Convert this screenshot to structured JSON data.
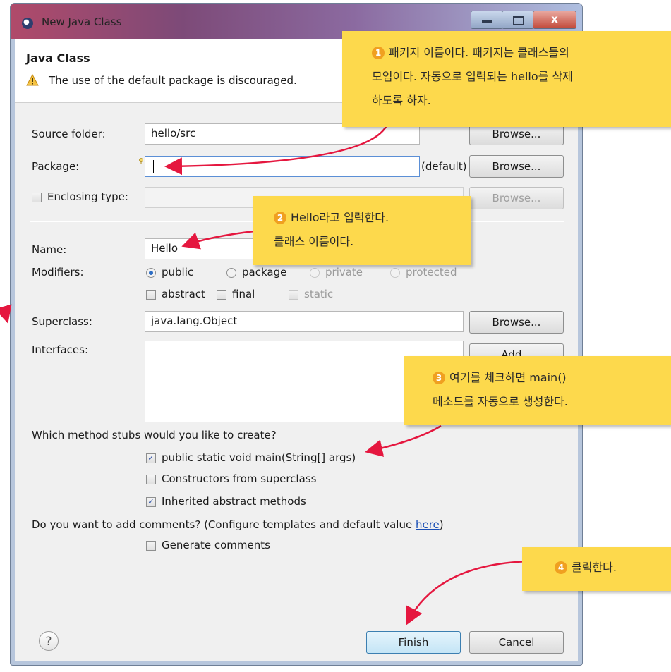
{
  "window": {
    "title": "New Java Class",
    "close_glyph": "x"
  },
  "header": {
    "title": "Java Class",
    "warning": "The use of the default package is discouraged."
  },
  "form": {
    "source_folder": {
      "label": "Source folder:",
      "value": "hello/src",
      "button": "Browse..."
    },
    "package": {
      "label": "Package:",
      "value": "",
      "suffix": "(default)",
      "button": "Browse..."
    },
    "enclosing": {
      "label": "Enclosing type:",
      "value": "",
      "button": "Browse...",
      "checked": false
    },
    "name": {
      "label": "Name:",
      "value": "Hello"
    },
    "modifiers": {
      "label": "Modifiers:",
      "options": [
        "public",
        "package",
        "private",
        "protected"
      ],
      "selected": "public",
      "checks": [
        "abstract",
        "final",
        "static"
      ]
    },
    "superclass": {
      "label": "Superclass:",
      "value": "java.lang.Object",
      "button": "Browse..."
    },
    "interfaces": {
      "label": "Interfaces:",
      "button": "Add..."
    },
    "stubs": {
      "question": "Which method stubs would you like to create?",
      "items": [
        {
          "label": "public static void main(String[] args)",
          "checked": true
        },
        {
          "label": "Constructors from superclass",
          "checked": false
        },
        {
          "label": "Inherited abstract methods",
          "checked": true
        }
      ]
    },
    "comments": {
      "question_prefix": "Do you want to add comments? (Configure templates and default value ",
      "link": "here",
      "question_suffix": ")",
      "generate": {
        "label": "Generate comments",
        "checked": false
      }
    }
  },
  "footer": {
    "help": "?",
    "finish": "Finish",
    "cancel": "Cancel"
  },
  "callouts": [
    {
      "num": "1",
      "lines": [
        "패키지 이름이다. 패키지는 클래스들의",
        "모임이다. 자동으로 입력되는 hello를 삭제",
        "하도록 하자."
      ]
    },
    {
      "num": "2",
      "lines": [
        "Hello라고 입력한다.",
        "클래스 이름이다."
      ]
    },
    {
      "num": "3",
      "lines": [
        "여기를 체크하면 main()",
        "메소드를 자동으로 생성한다."
      ]
    },
    {
      "num": "4",
      "lines": [
        "클릭한다."
      ]
    }
  ],
  "colors": {
    "callout": "#fdd94c",
    "arrow": "#e5173f",
    "link": "#1a4fb5"
  }
}
